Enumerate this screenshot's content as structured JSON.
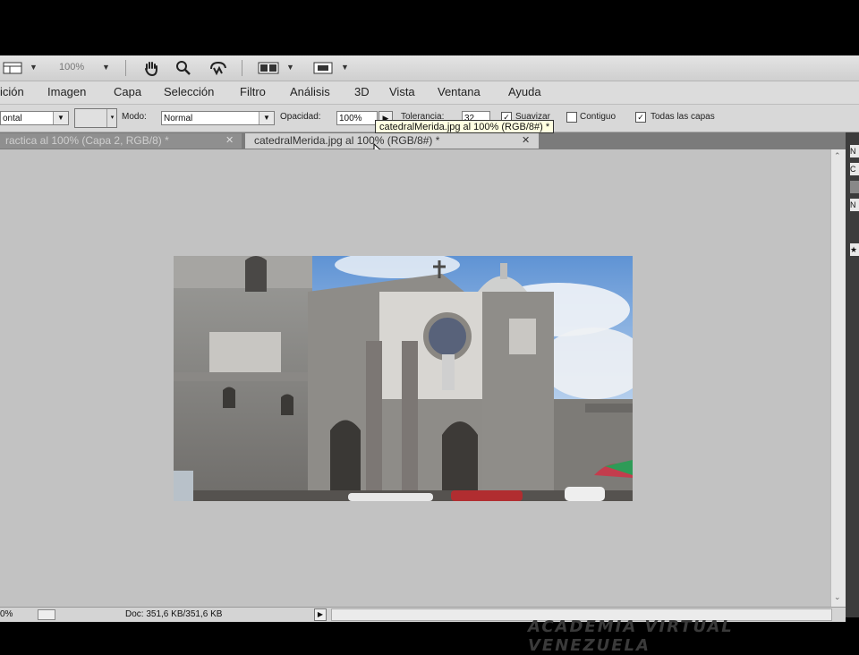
{
  "toolbar": {
    "zoom_value": "100%",
    "icons": [
      "layout-icon",
      "hand-tool-icon",
      "zoom-tool-icon",
      "rotate-view-icon",
      "arrange-documents-icon",
      "screen-mode-icon"
    ]
  },
  "menu": {
    "items": [
      "ición",
      "Imagen",
      "Capa",
      "Selección",
      "Filtro",
      "Análisis",
      "3D",
      "Vista",
      "Ventana",
      "Ayuda"
    ]
  },
  "options": {
    "fill_select": "ontal",
    "mode_label": "Modo:",
    "mode_value": "Normal",
    "opacity_label": "Opacidad:",
    "opacity_value": "100%",
    "tolerance_label": "Tolerancia:",
    "tolerance_value": "32",
    "antialias_label": "Suavizar",
    "contiguous_label": "Contiguo",
    "all_layers_label": "Todas las capas",
    "antialias_checked": true,
    "contiguous_checked": false,
    "all_layers_checked": true
  },
  "tabs": [
    {
      "label": "ractica al 100% (Capa 2, RGB/8) *",
      "active": false
    },
    {
      "label": "catedralMerida.jpg al 100% (RGB/8#) *",
      "active": true
    }
  ],
  "tooltip": "catedralMerida.jpg al 100% (RGB/8#) *",
  "status": {
    "zoom": "0%",
    "doc_info": "Doc: 351,6 KB/351,6 KB"
  },
  "watermark": "ACADEMIA VIRTUAL VENEZUELA",
  "colors": {
    "canvas_bg": "#c2c2c2",
    "chrome": "#d8d8d8",
    "tab_bar": "#7b7b7b",
    "sky": "#6e9fd6"
  }
}
